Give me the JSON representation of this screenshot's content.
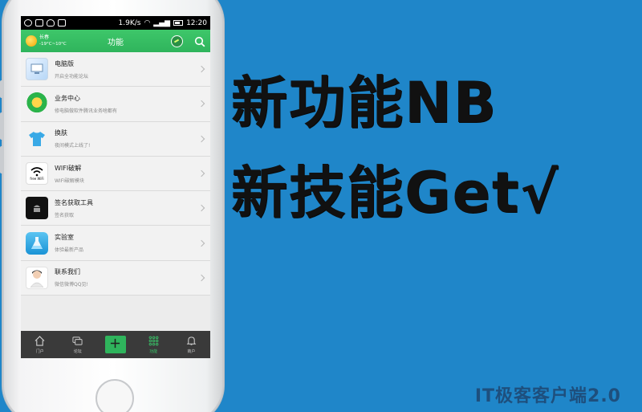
{
  "statusbar": {
    "speed": "1.9K/s",
    "time": "12:20"
  },
  "header": {
    "weather_city": "长春",
    "weather_temp": "-19°C~10°C",
    "title": "功能"
  },
  "menu": [
    {
      "icon": "computer-icon",
      "title": "电脑版",
      "subtitle": "开启全功能论坛"
    },
    {
      "icon": "business-gift-icon",
      "title": "业务中心",
      "subtitle": "修电脑做软件腾讯业务啥都有"
    },
    {
      "icon": "tshirt-icon",
      "title": "换肤",
      "subtitle": "夜间模式上线了!"
    },
    {
      "icon": "wifi-icon",
      "title": "WIFI破解",
      "subtitle": "WIFI破解模块",
      "icon_text": "free WiFi"
    },
    {
      "icon": "android-icon",
      "title": "签名获取工具",
      "subtitle": "签名获取"
    },
    {
      "icon": "flask-icon",
      "title": "实验室",
      "subtitle": "体验最新产品"
    },
    {
      "icon": "contact-person-icon",
      "title": "联系我们",
      "subtitle": "微信微博QQ见!"
    }
  ],
  "tabs": [
    {
      "label": "门户",
      "icon": "home-icon",
      "active": false
    },
    {
      "label": "论坛",
      "icon": "chat-icon",
      "active": false
    },
    {
      "label": "",
      "icon": "plus-icon",
      "active": false
    },
    {
      "label": "功能",
      "icon": "grid-icon",
      "active": true
    },
    {
      "label": "商户",
      "icon": "bell-icon",
      "active": false
    }
  ],
  "promo": {
    "line1": "新功能NB",
    "line2": "新技能Get√"
  },
  "brand": "IT极客客户端2.0",
  "colors": {
    "background": "#1f86c9",
    "accent": "#2fb45c",
    "tabbar": "#3a3a3a"
  }
}
